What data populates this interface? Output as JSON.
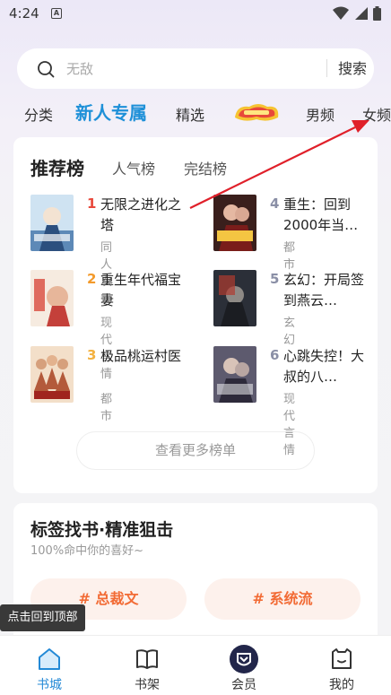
{
  "status_bar": {
    "time": "4:24",
    "notification_letter": "A"
  },
  "search": {
    "placeholder": "无敌",
    "button_label": "搜索"
  },
  "tabs": [
    {
      "label": "分类"
    },
    {
      "label": "新人专属"
    },
    {
      "label": "精选"
    },
    {
      "label": "男频"
    },
    {
      "label": "女频"
    }
  ],
  "rank": {
    "tabs": [
      {
        "label": "推荐榜"
      },
      {
        "label": "人气榜"
      },
      {
        "label": "完结榜"
      }
    ],
    "books": [
      {
        "rank": "1",
        "title": "无限之进化之塔",
        "category": "同人次元",
        "rank_color": "#e8483b"
      },
      {
        "rank": "2",
        "title": "重生年代福宝妻",
        "category": "现代言情",
        "rank_color": "#f39a2b"
      },
      {
        "rank": "3",
        "title": "极品桃运村医",
        "category": "都市",
        "rank_color": "#f3b13f"
      },
      {
        "rank": "4",
        "title": "重生：回到2000年当…",
        "category": "都市",
        "rank_color": "#8a8fa6"
      },
      {
        "rank": "5",
        "title": "玄幻：开局签到燕云…",
        "category": "玄幻",
        "rank_color": "#8a8fa6"
      },
      {
        "rank": "6",
        "title": "心跳失控！大叔的八…",
        "category": "现代言情",
        "rank_color": "#8a8fa6"
      }
    ],
    "more_label": "查看更多榜单"
  },
  "tag_section": {
    "title": "标签找书·精准狙击",
    "subtitle": "100%命中你的喜好~",
    "tags": [
      {
        "label": "# 总裁文"
      },
      {
        "label": "# 系统流"
      }
    ]
  },
  "toast": "点击回到顶部",
  "bottom_nav": [
    {
      "label": "书城"
    },
    {
      "label": "书架"
    },
    {
      "label": "会员"
    },
    {
      "label": "我的"
    }
  ],
  "colors": {
    "accent": "#1e90d8",
    "tag_text": "#f26b35",
    "arrow": "#e0202a"
  }
}
